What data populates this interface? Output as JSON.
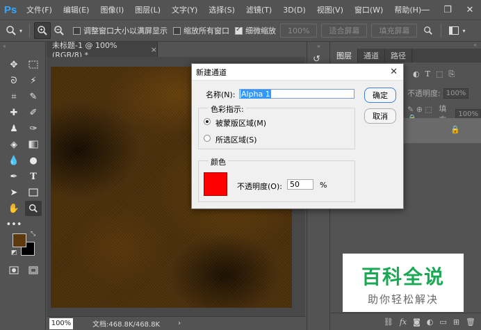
{
  "app": {
    "logo": "Ps"
  },
  "menu": [
    "文件(F)",
    "编辑(E)",
    "图像(I)",
    "图层(L)",
    "文字(Y)",
    "选择(S)",
    "滤镜(T)",
    "3D(D)",
    "视图(V)",
    "窗口(W)",
    "帮助(H)"
  ],
  "window_controls": {
    "minimize": "—",
    "restore": "❐",
    "close": "✕"
  },
  "options": {
    "resize_windows": "调整窗口大小以满屏显示",
    "zoom_all": "缩放所有窗口",
    "scrubby_zoom": "细微缩放",
    "zoom_level_button": "100%",
    "fit_screen": "适合屏幕",
    "fill_screen": "填充屏幕",
    "resize_checked": false,
    "zoom_all_checked": false,
    "scrubby_checked": true
  },
  "document": {
    "tab_title": "未标题-1 @ 100%(RGB/8) *",
    "tab_close": "×",
    "zoom": "100%",
    "doc_info": "文档:468.8K/468.8K",
    "status_arrow": "›"
  },
  "colors": {
    "foreground": "#5c3a0e",
    "background": "#000000",
    "channel_color": "#ff0000",
    "watermark_green": "#1aa854"
  },
  "layers_panel": {
    "tabs": [
      "图层",
      "通道",
      "路径"
    ],
    "active_tab": "图层",
    "opacity_label": "不透明度:",
    "opacity_value": "100%",
    "fill_label": "填充:",
    "fill_value": "100%",
    "bottom_icons": [
      "link-icon",
      "fx-icon",
      "mask-icon",
      "adjustment-icon",
      "group-icon",
      "new-layer-icon",
      "trash-icon"
    ]
  },
  "dialog": {
    "title": "新建通道",
    "name_label": "名称(N):",
    "name_value": "Alpha 1",
    "ok": "确定",
    "cancel": "取消",
    "color_indicates_label": "色彩指示:",
    "masked_areas": "被蒙版区域(M)",
    "selected_areas": "所选区域(S)",
    "masked_selected": true,
    "color_group_label": "颜色",
    "opacity_label": "不透明度(O):",
    "opacity_value": "50",
    "percent": "%"
  },
  "watermark": {
    "title": "百科全说",
    "subtitle": "助你轻松解决"
  }
}
